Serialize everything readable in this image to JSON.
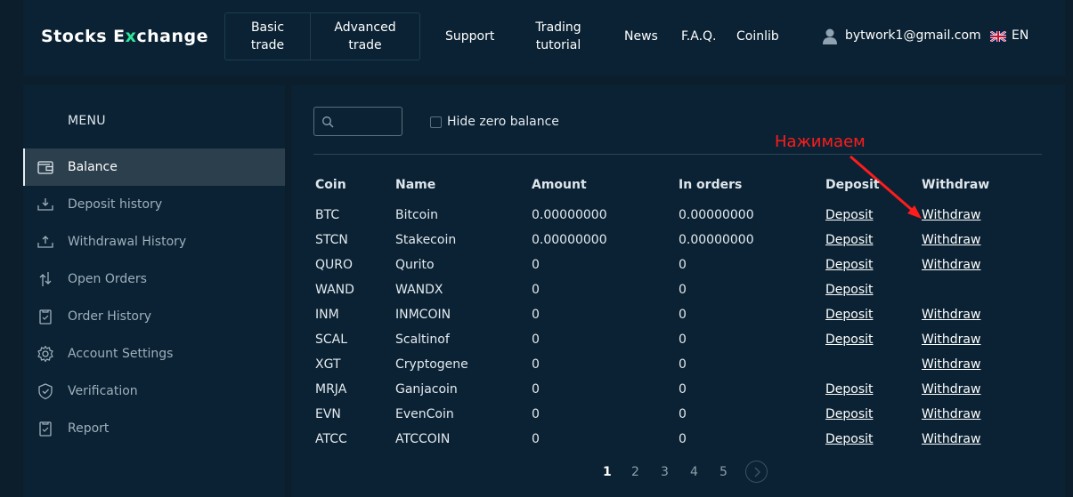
{
  "header": {
    "logo_pre": "Stocks E",
    "logo_x": "x",
    "logo_post": "change",
    "basic_trade": "Basic trade",
    "advanced_trade": "Advanced trade",
    "support": "Support",
    "trading_tutorial": "Trading tutorial",
    "news": "News",
    "faq": "F.A.Q.",
    "coinlib": "Coinlib",
    "user_email": "bytwork1@gmail.com",
    "lang": "EN",
    "accent_color": "#2ee89c"
  },
  "sidebar": {
    "menu_title": "MENU",
    "items": [
      {
        "label": "Balance",
        "icon": "wallet-icon"
      },
      {
        "label": "Deposit history",
        "icon": "deposit-tray-icon"
      },
      {
        "label": "Withdrawal History",
        "icon": "withdraw-tray-icon"
      },
      {
        "label": "Open Orders",
        "icon": "exchange-arrows-icon"
      },
      {
        "label": "Order History",
        "icon": "clipboard-icon"
      },
      {
        "label": "Account Settings",
        "icon": "gear-icon"
      },
      {
        "label": "Verification",
        "icon": "shield-check-icon"
      },
      {
        "label": "Report",
        "icon": "report-clipboard-icon"
      }
    ]
  },
  "main": {
    "search": {
      "placeholder": "",
      "value": ""
    },
    "hide_zero_label": "Hide zero balance",
    "annotation": "Нажимаем",
    "annotation_color": "#ff1c1c",
    "columns": [
      "Coin",
      "Name",
      "Amount",
      "In orders",
      "Deposit",
      "Withdraw"
    ],
    "rows": [
      {
        "coin": "BTC",
        "name": "Bitcoin",
        "amount": "0.00000000",
        "in_orders": "0.00000000",
        "deposit": "Deposit",
        "withdraw": "Withdraw"
      },
      {
        "coin": "STCN",
        "name": "Stakecoin",
        "amount": "0.00000000",
        "in_orders": "0.00000000",
        "deposit": "Deposit",
        "withdraw": "Withdraw"
      },
      {
        "coin": "QURO",
        "name": "Qurito",
        "amount": "0",
        "in_orders": "0",
        "deposit": "Deposit",
        "withdraw": "Withdraw"
      },
      {
        "coin": "WAND",
        "name": "WANDX",
        "amount": "0",
        "in_orders": "0",
        "deposit": "Deposit",
        "withdraw": ""
      },
      {
        "coin": "INM",
        "name": "INMCOIN",
        "amount": "0",
        "in_orders": "0",
        "deposit": "Deposit",
        "withdraw": "Withdraw"
      },
      {
        "coin": "SCAL",
        "name": "Scaltinof",
        "amount": "0",
        "in_orders": "0",
        "deposit": "Deposit",
        "withdraw": "Withdraw"
      },
      {
        "coin": "XGT",
        "name": "Cryptogene",
        "amount": "0",
        "in_orders": "0",
        "deposit": "",
        "withdraw": "Withdraw"
      },
      {
        "coin": "MRJA",
        "name": "Ganjacoin",
        "amount": "0",
        "in_orders": "0",
        "deposit": "Deposit",
        "withdraw": "Withdraw"
      },
      {
        "coin": "EVN",
        "name": "EvenCoin",
        "amount": "0",
        "in_orders": "0",
        "deposit": "Deposit",
        "withdraw": "Withdraw"
      },
      {
        "coin": "ATCC",
        "name": "ATCCOIN",
        "amount": "0",
        "in_orders": "0",
        "deposit": "Deposit",
        "withdraw": "Withdraw"
      }
    ],
    "pages": [
      "1",
      "2",
      "3",
      "4",
      "5"
    ],
    "current_page": "1"
  }
}
